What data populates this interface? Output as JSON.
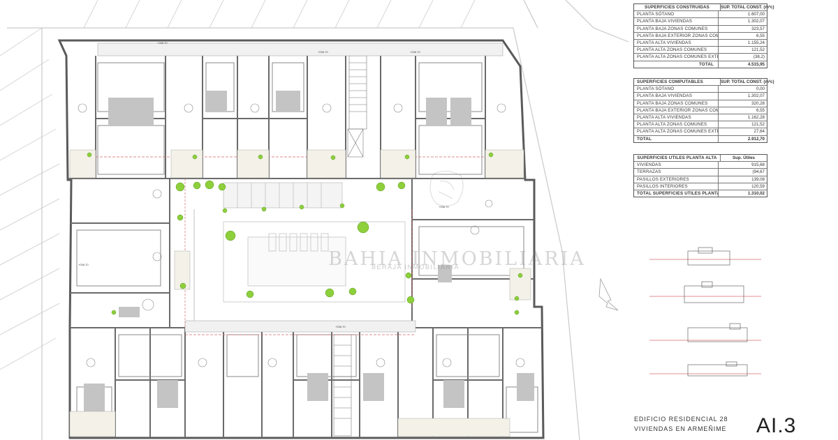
{
  "tables": {
    "construidas": {
      "header": [
        "SUPERFICIES CONSTRUIDAS",
        "SUP. TOTAL CONST. (m²c)"
      ],
      "rows": [
        [
          "PLANTA SÓTANO",
          "1.607,00"
        ],
        [
          "PLANTA BAJA VIVIENDAS",
          "1.302,07"
        ],
        [
          "PLANTA BAJA ZONAS COMUNES",
          "323,57"
        ],
        [
          "PLANTA BAJA EXTERIOR ZONAS COMUNES",
          "6,55"
        ],
        [
          "PLANTA ALTA VIVIENDAS",
          "1.155,24"
        ],
        [
          "PLANTA ALTA ZONAS COMUNES",
          "121,52"
        ],
        [
          "PLANTA ALTA ZONAS COMUNES EXTERIORES",
          "(38,2)"
        ]
      ],
      "total": [
        "TOTAL",
        "4.515,95"
      ]
    },
    "computables": {
      "header": [
        "SUPERFICIES COMPUTABLES",
        "SUP. TOTAL CONST. (m²c)"
      ],
      "rows": [
        [
          "PLANTA SÓTANO",
          "0,00"
        ],
        [
          "PLANTA BAJA VIVIENDAS",
          "1.302,07"
        ],
        [
          "PLANTA BAJA ZONAS COMUNES",
          "320,28"
        ],
        [
          "PLANTA BAJA EXTERIOR ZONAS COMUNES",
          "6,55"
        ],
        [
          "PLANTA ALTA VIVIENDAS",
          "1.162,28"
        ],
        [
          "PLANTA ALTA ZONAS COMUNES",
          "121,52"
        ],
        [
          "PLANTA ALTA ZONAS COMUNES EXTERIORES",
          "27,64"
        ]
      ],
      "total": [
        "TOTAL",
        "2.912,70"
      ]
    },
    "utiles": {
      "header": [
        "SUPERFICIES UTILES PLANTA ALTA",
        "Sup. Útiles"
      ],
      "rows": [
        [
          "VIVIENDAS",
          "915,68"
        ],
        [
          "TERRAZAS",
          "(94,67"
        ],
        [
          "PASILLOS EXTERIORES",
          "139,08"
        ],
        [
          "PASILLOS INTERIORES",
          "120,59"
        ]
      ],
      "total": [
        "TOTAL SUPERFICIES UTILES PLANTA ALTA",
        "1.310,02"
      ]
    }
  },
  "title_block": {
    "line1": "EDIFICIO RESIDENCIAL 28",
    "line2": "VIVIENDAS EN ARMEÑIME",
    "sheet": "AI.3"
  },
  "watermark": {
    "name": "BAHIA INMOBILIARIA",
    "sub": "BERAJA INMOBILIARIA"
  },
  "level_markers": [
    "+036.70",
    "+036.70",
    "+036.70",
    "+036.70",
    "+036.70",
    "+036.70"
  ],
  "colors": {
    "wall": "#5a5a5a",
    "tree": "#8ecf3c",
    "section_line": "#d66a6a",
    "grey_fill": "#bdbdbd"
  }
}
